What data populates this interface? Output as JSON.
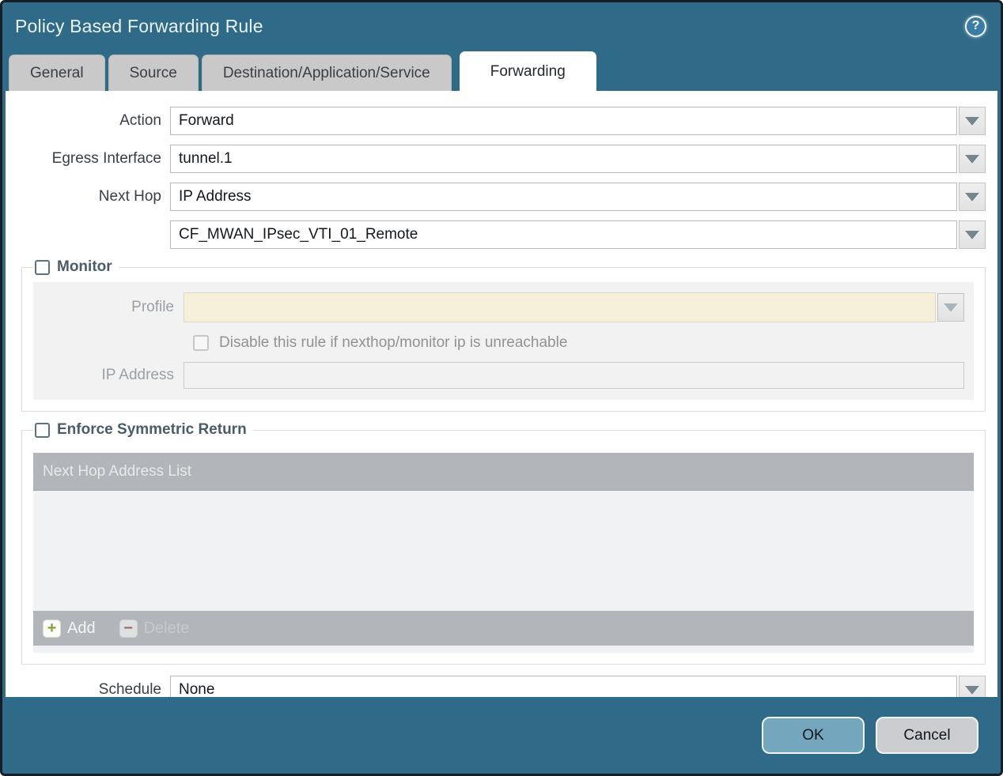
{
  "dialog": {
    "title": "Policy Based Forwarding Rule"
  },
  "icons": {
    "help_glyph": "?",
    "add_glyph": "+",
    "delete_glyph": "−"
  },
  "tabs": [
    {
      "label": "General",
      "active": false
    },
    {
      "label": "Source",
      "active": false
    },
    {
      "label": "Destination/Application/Service",
      "active": false
    },
    {
      "label": "Forwarding",
      "active": true
    }
  ],
  "form": {
    "action": {
      "label": "Action",
      "value": "Forward"
    },
    "egress_interface": {
      "label": "Egress Interface",
      "value": "tunnel.1"
    },
    "next_hop": {
      "label": "Next Hop",
      "value": "IP Address"
    },
    "next_hop_address": {
      "value": "CF_MWAN_IPsec_VTI_01_Remote"
    },
    "schedule": {
      "label": "Schedule",
      "value": "None"
    }
  },
  "monitor": {
    "legend": "Monitor",
    "checked": false,
    "profile": {
      "label": "Profile",
      "value": ""
    },
    "disable_rule_checkbox": {
      "label": "Disable this rule if nexthop/monitor ip is unreachable",
      "checked": false,
      "disabled": true
    },
    "ip_address": {
      "label": "IP Address",
      "value": ""
    }
  },
  "enforce_symmetric_return": {
    "legend": "Enforce Symmetric Return",
    "checked": false,
    "table": {
      "header": "Next Hop Address List",
      "rows": []
    },
    "toolbar": {
      "add_label": "Add",
      "delete_label": "Delete",
      "delete_disabled": true
    }
  },
  "footer": {
    "ok_label": "OK",
    "cancel_label": "Cancel"
  },
  "colors": {
    "titlebar_teal": "#2f6b89",
    "active_tab_bg": "#ffffff",
    "inactive_tab_bg": "#c9c9c9",
    "disabled_profile_beige": "#f6efda",
    "table_header_gray": "#b2b5b9",
    "section_bg_gray": "#f2f2f3",
    "ok_button_blue": "#74a7bd",
    "cancel_button_gray": "#cbcdd1",
    "add_icon_green": "#7fa23b",
    "delete_icon_red": "#9c6f65"
  }
}
